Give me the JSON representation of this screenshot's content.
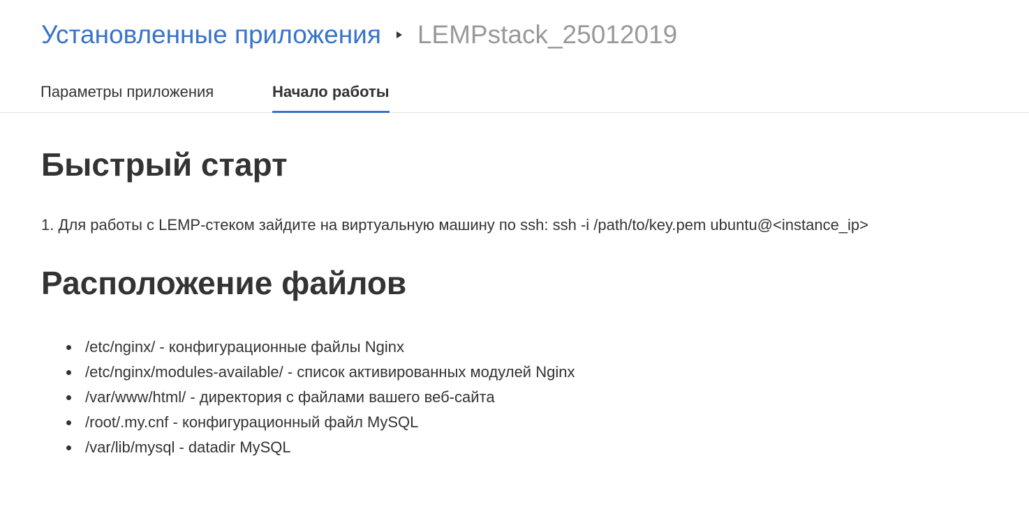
{
  "breadcrumb": {
    "parent": "Установленные приложения",
    "current": "LEMPstack_25012019"
  },
  "tabs": [
    {
      "label": "Параметры приложения",
      "active": false
    },
    {
      "label": "Начало работы",
      "active": true
    }
  ],
  "quick_start": {
    "heading": "Быстрый старт",
    "step_1": "1. Для работы с LEMP-стеком зайдите на виртуальную машину по ssh: ssh -i /path/to/key.pem ubuntu@<instance_ip>"
  },
  "files": {
    "heading": "Расположение файлов",
    "items": [
      "/etc/nginx/ - конфигурационные файлы Nginx",
      "/etc/nginx/modules-available/ - список активированных модулей Nginx",
      "/var/www/html/ - директория с файлами вашего веб-сайта",
      "/root/.my.cnf - конфигурационный файл MySQL",
      "/var/lib/mysql - datadir MySQL"
    ]
  },
  "colors": {
    "accent": "#3873c9",
    "text": "#333333",
    "muted": "#999999"
  }
}
